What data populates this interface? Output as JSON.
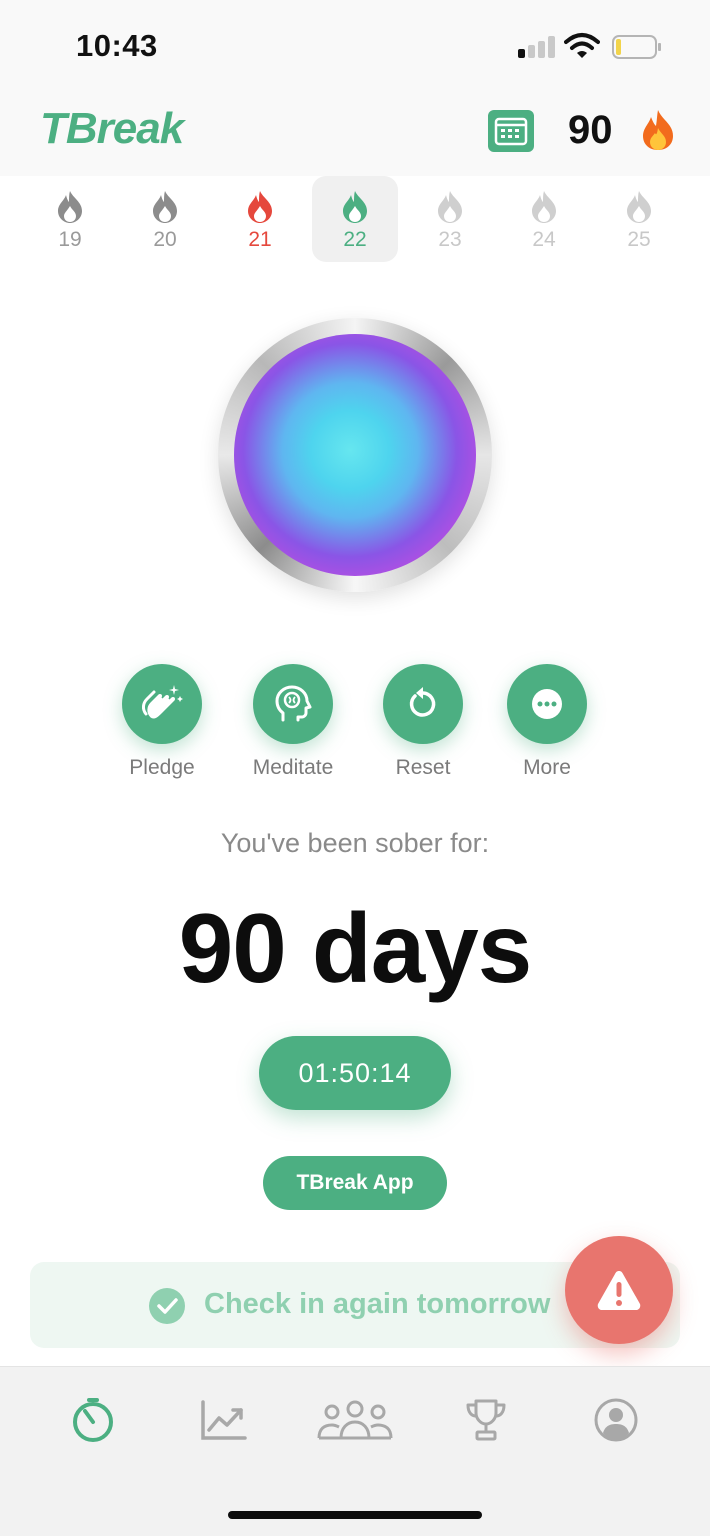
{
  "status_bar": {
    "time": "10:43"
  },
  "header": {
    "logo": "TBreak",
    "streak_count": "90"
  },
  "week": [
    {
      "label": "19",
      "state": "past"
    },
    {
      "label": "20",
      "state": "past"
    },
    {
      "label": "21",
      "state": "relapse"
    },
    {
      "label": "22",
      "state": "today"
    },
    {
      "label": "23",
      "state": "future"
    },
    {
      "label": "24",
      "state": "future"
    },
    {
      "label": "25",
      "state": "future"
    }
  ],
  "actions": [
    {
      "label": "Pledge",
      "icon": "clapping-hands-icon"
    },
    {
      "label": "Meditate",
      "icon": "brain-head-icon"
    },
    {
      "label": "Reset",
      "icon": "reset-icon"
    },
    {
      "label": "More",
      "icon": "more-icon"
    }
  ],
  "main": {
    "sober_label": "You've been sober for:",
    "days": "90 days",
    "timer": "01:50:14",
    "app_button": "TBreak App",
    "checkin_text": "Check in again tomorrow"
  },
  "colors": {
    "accent": "#4caf82",
    "danger": "#e8756e",
    "relapse": "#e5483d"
  },
  "tabs": [
    "timer-icon",
    "progress-chart-icon",
    "community-icon",
    "trophy-icon",
    "profile-icon"
  ]
}
